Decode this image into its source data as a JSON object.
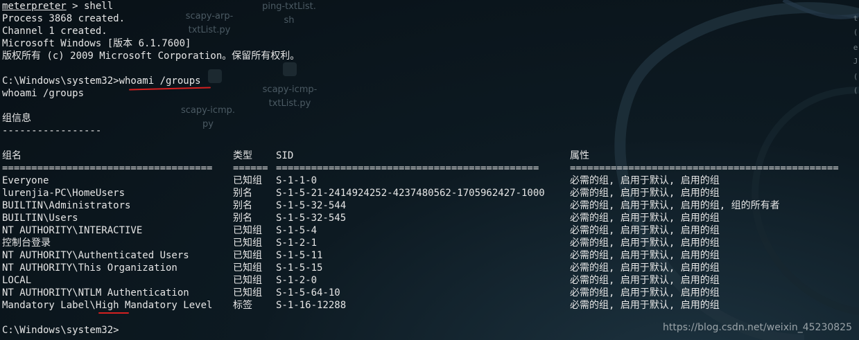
{
  "desktop": {
    "icons": [
      {
        "label": "scapy-arp-\ntxtList.py"
      },
      {
        "label": "ping-txtList.\nsh"
      },
      {
        "label": "scapy-icmp-\ntxtList.py"
      },
      {
        "label": "scapy-icmp.\npy"
      }
    ]
  },
  "terminal": {
    "prompt_meterpreter": "meterpreter",
    "prompt_suffix": " > shell",
    "output_lines": [
      "Process 3868 created.",
      "Channel 1 created.",
      "Microsoft Windows [版本 6.1.7600]",
      "版权所有 (c) 2009 Microsoft Corporation。保留所有权利。"
    ],
    "cmd_prompt": "C:\\Windows\\system32>",
    "command": "whoami /groups",
    "echo": "whoami /groups",
    "section_title": "组信息",
    "section_rule": "-----------------",
    "table": {
      "headers": [
        "组名",
        "类型",
        "SID",
        "属性"
      ],
      "separators": [
        "====================================",
        "======",
        "=============================================",
        "=============================================="
      ],
      "rows": [
        [
          "Everyone",
          "已知组",
          "S-1-1-0",
          "必需的组, 启用于默认, 启用的组"
        ],
        [
          "lurenjia-PC\\HomeUsers",
          "别名",
          "S-1-5-21-2414924252-4237480562-1705962427-1000",
          "必需的组, 启用于默认, 启用的组"
        ],
        [
          "BUILTIN\\Administrators",
          "别名",
          "S-1-5-32-544",
          "必需的组, 启用于默认, 启用的组, 组的所有者"
        ],
        [
          "BUILTIN\\Users",
          "别名",
          "S-1-5-32-545",
          "必需的组, 启用于默认, 启用的组"
        ],
        [
          "NT AUTHORITY\\INTERACTIVE",
          "已知组",
          "S-1-5-4",
          "必需的组, 启用于默认, 启用的组"
        ],
        [
          "控制台登录",
          "已知组",
          "S-1-2-1",
          "必需的组, 启用于默认, 启用的组"
        ],
        [
          "NT AUTHORITY\\Authenticated Users",
          "已知组",
          "S-1-5-11",
          "必需的组, 启用于默认, 启用的组"
        ],
        [
          "NT AUTHORITY\\This Organization",
          "已知组",
          "S-1-5-15",
          "必需的组, 启用于默认, 启用的组"
        ],
        [
          "LOCAL",
          "已知组",
          "S-1-2-0",
          "必需的组, 启用于默认, 启用的组"
        ],
        [
          "NT AUTHORITY\\NTLM Authentication",
          "已知组",
          "S-1-5-64-10",
          "必需的组, 启用于默认, 启用的组"
        ],
        [
          "Mandatory Label\\High Mandatory Level",
          "标签",
          "S-1-16-12288",
          "必需的组, 启用于默认, 启用的组"
        ]
      ]
    },
    "final_prompt": "C:\\Windows\\system32>"
  },
  "side_glyphs": [
    "t",
    "(",
    "e",
    "J",
    "(",
    "("
  ],
  "annotation_color": "#d62020",
  "watermark": "https://blog.csdn.net/weixin_45230825"
}
